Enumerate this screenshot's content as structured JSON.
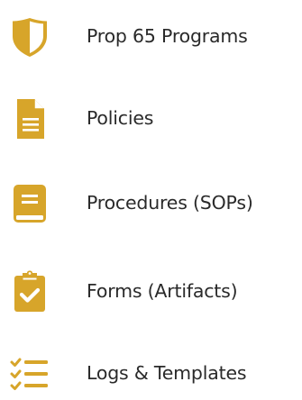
{
  "colors": {
    "accent": "#D7A52A",
    "accent_dark": "#B98A17",
    "text": "#2A2A2A",
    "background": "#FFFFFF"
  },
  "menu": {
    "items": [
      {
        "label": "Prop 65 Programs",
        "icon": "shield-icon"
      },
      {
        "label": "Policies",
        "icon": "document-icon"
      },
      {
        "label": "Procedures (SOPs)",
        "icon": "book-icon"
      },
      {
        "label": "Forms (Artifacts)",
        "icon": "clipboard-check-icon"
      },
      {
        "label": "Logs & Templates",
        "icon": "checklist-icon"
      }
    ]
  }
}
